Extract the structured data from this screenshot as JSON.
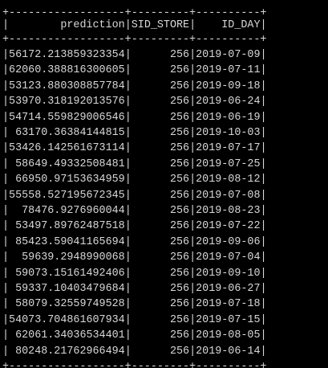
{
  "colors": {
    "background": "#000000",
    "text": "#d8d8d8"
  },
  "table": {
    "border_line": "+------------------+---------+----------+",
    "top_clipped_line": "+------------------+---------+----------+",
    "headers": [
      "prediction",
      "SID_STORE",
      "ID_DAY"
    ],
    "col_widths": [
      18,
      9,
      10
    ],
    "rows": [
      [
        "56172.213859323354",
        "256",
        "2019-07-09"
      ],
      [
        "62060.388816300605",
        "256",
        "2019-07-11"
      ],
      [
        "53123.880308857784",
        "256",
        "2019-09-18"
      ],
      [
        "53970.318192013576",
        "256",
        "2019-06-24"
      ],
      [
        "54714.559829006546",
        "256",
        "2019-06-19"
      ],
      [
        "63170.36384144815",
        "256",
        "2019-10-03"
      ],
      [
        "53426.142561673114",
        "256",
        "2019-07-17"
      ],
      [
        "58649.49332508481",
        "256",
        "2019-07-25"
      ],
      [
        "66950.97153634959",
        "256",
        "2019-08-12"
      ],
      [
        "55558.527195672345",
        "256",
        "2019-07-08"
      ],
      [
        "78476.9276960044",
        "256",
        "2019-08-23"
      ],
      [
        "53497.89762487518",
        "256",
        "2019-07-22"
      ],
      [
        "85423.59041165694",
        "256",
        "2019-09-06"
      ],
      [
        "59639.2948990068",
        "256",
        "2019-07-04"
      ],
      [
        "59073.15161492406",
        "256",
        "2019-09-10"
      ],
      [
        "59337.10403479684",
        "256",
        "2019-06-27"
      ],
      [
        "58079.32559749528",
        "256",
        "2019-07-18"
      ],
      [
        "54073.704861607934",
        "256",
        "2019-07-15"
      ],
      [
        "62061.34036534401",
        "256",
        "2019-08-05"
      ],
      [
        "80248.21762966494",
        "256",
        "2019-06-14"
      ]
    ]
  }
}
